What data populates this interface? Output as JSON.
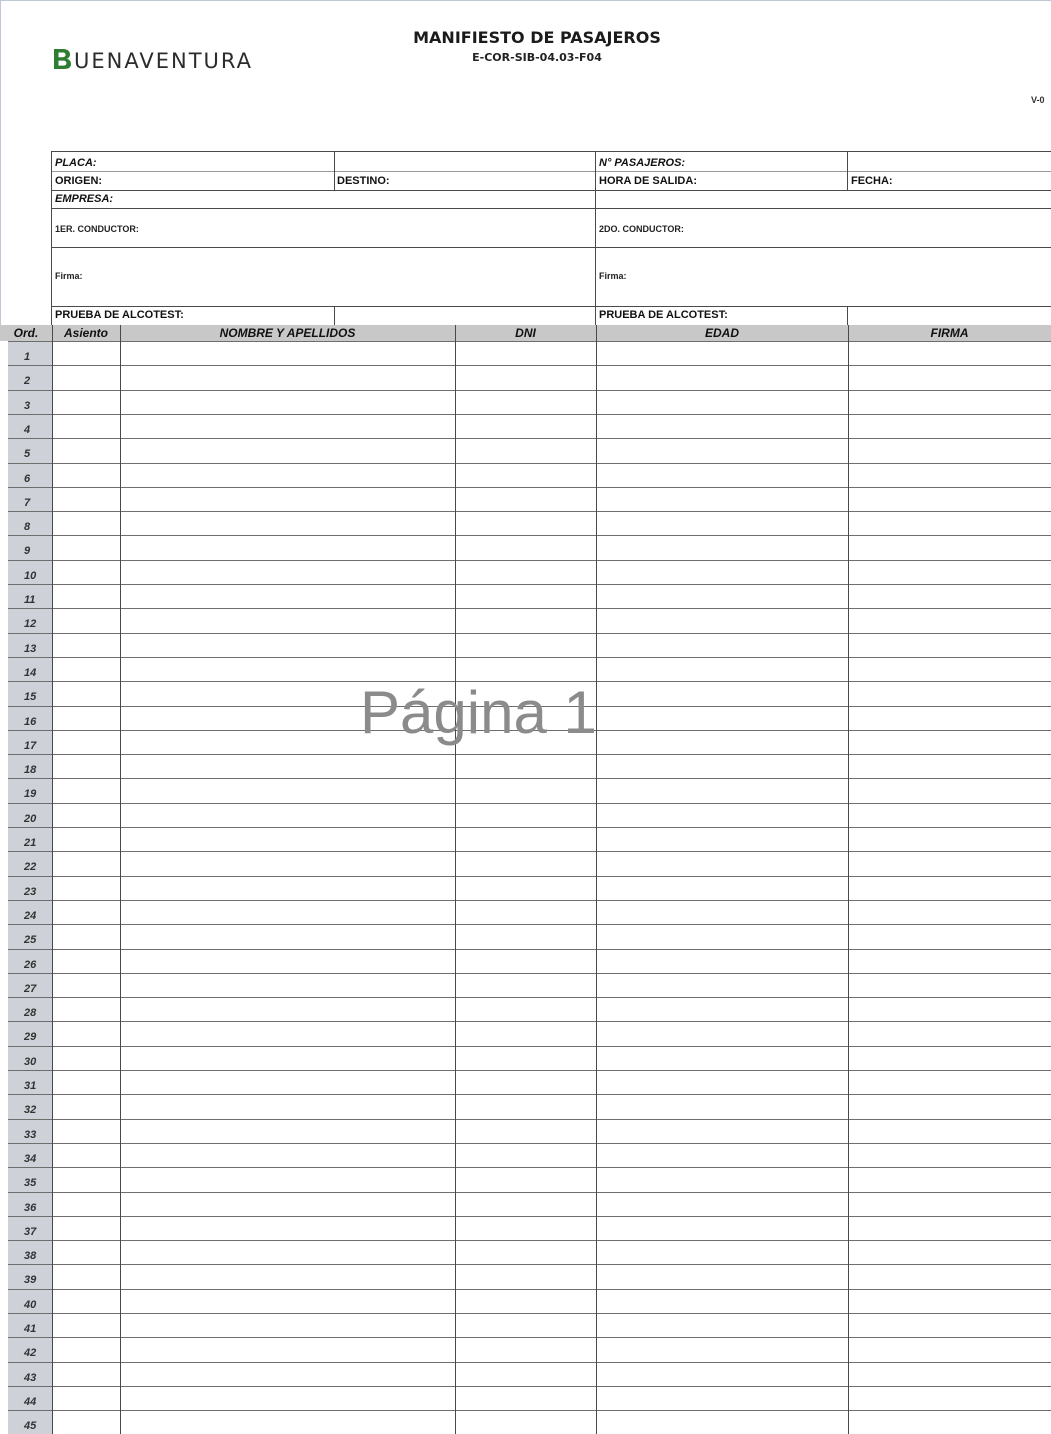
{
  "header": {
    "logo_text": "UENAVENTURA",
    "title": "MANIFIESTO DE PASAJEROS",
    "code": "E-COR-SIB-04.03-F04",
    "version": "V-0"
  },
  "info": {
    "placa": "PLACA:",
    "n_pasajeros": "N° PASAJEROS:",
    "origen": "ORIGEN:",
    "destino": "DESTINO:",
    "hora_salida": "HORA DE SALIDA:",
    "fecha": "FECHA:",
    "empresa": "EMPRESA:",
    "conductor1": "1ER. CONDUCTOR:",
    "conductor2": "2DO. CONDUCTOR:",
    "firma1": "Firma:",
    "firma2": "Firma:",
    "alcotest1": "PRUEBA DE ALCOTEST:",
    "alcotest2": "PRUEBA DE ALCOTEST:"
  },
  "table": {
    "columns": [
      "Ord.",
      "Asiento",
      "NOMBRE Y APELLIDOS",
      "DNI",
      "EDAD",
      "FIRMA"
    ],
    "rows": [
      "1",
      "2",
      "3",
      "4",
      "5",
      "6",
      "7",
      "8",
      "9",
      "10",
      "11",
      "12",
      "13",
      "14",
      "15",
      "16",
      "17",
      "18",
      "19",
      "20",
      "21",
      "22",
      "23",
      "24",
      "25",
      "26",
      "27",
      "28",
      "29",
      "30",
      "31",
      "32",
      "33",
      "34",
      "35",
      "36",
      "37",
      "38",
      "39",
      "40",
      "41",
      "42",
      "43",
      "44",
      "45"
    ]
  },
  "watermark": "Página 1",
  "colors": {
    "logo_mark": "#2e7d32",
    "header_fill": "#c8c8c8",
    "ord_column": "#cfd1d9"
  }
}
